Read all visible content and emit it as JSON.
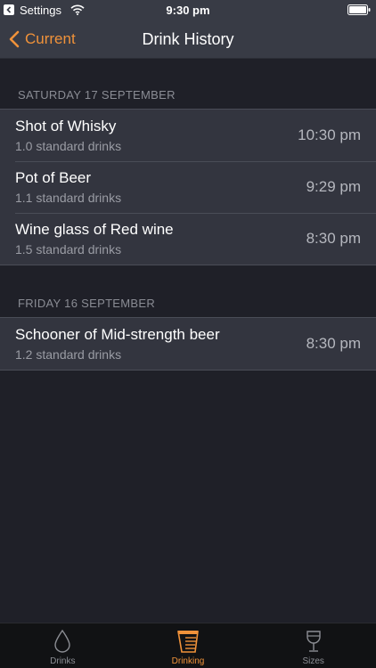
{
  "status_bar": {
    "back_app": "Settings",
    "time": "9:30 pm"
  },
  "nav": {
    "back_label": "Current",
    "title": "Drink History"
  },
  "sections": [
    {
      "header": "SATURDAY 17 SEPTEMBER",
      "rows": [
        {
          "title": "Shot of Whisky",
          "subtitle": "1.0 standard drinks",
          "time": "10:30 pm"
        },
        {
          "title": "Pot of Beer",
          "subtitle": "1.1 standard drinks",
          "time": "9:29 pm"
        },
        {
          "title": "Wine glass of Red wine",
          "subtitle": "1.5 standard drinks",
          "time": "8:30 pm"
        }
      ]
    },
    {
      "header": "FRIDAY 16 SEPTEMBER",
      "rows": [
        {
          "title": "Schooner of Mid-strength beer",
          "subtitle": "1.2 standard drinks",
          "time": "8:30 pm"
        }
      ]
    }
  ],
  "tabs": [
    {
      "label": "Drinks",
      "icon": "drop-icon"
    },
    {
      "label": "Drinking",
      "icon": "drinking-glass-icon",
      "active": true
    },
    {
      "label": "Sizes",
      "icon": "wine-glass-icon"
    }
  ],
  "colors": {
    "accent": "#f0923a",
    "background": "#1f2028",
    "bar": "#383b45",
    "cell": "#33353f",
    "tab_bar": "#111214"
  }
}
